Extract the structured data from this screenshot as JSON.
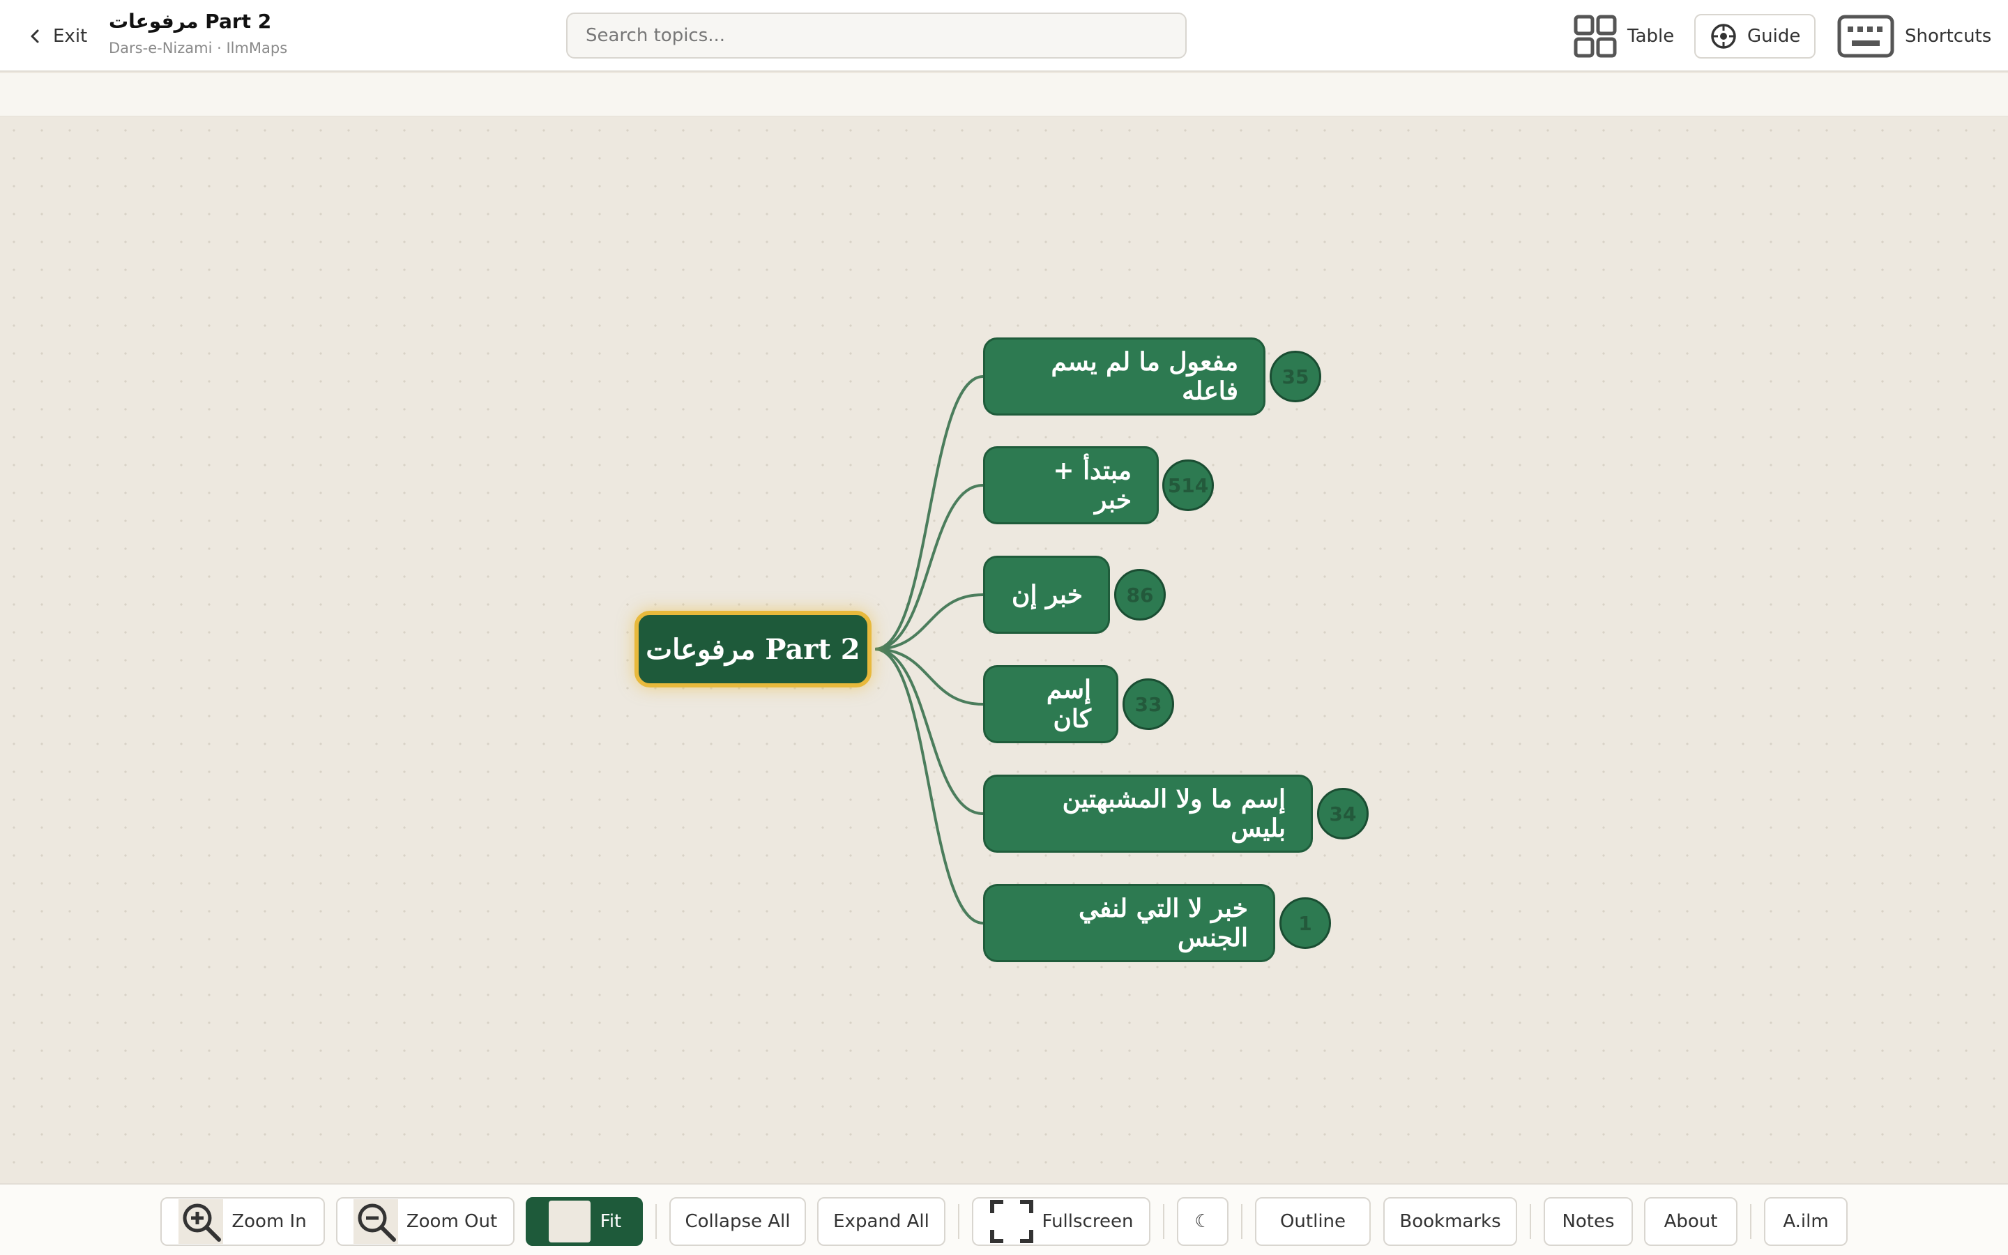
{
  "header": {
    "exit_label": "Exit",
    "title": "مرفوعات Part 2",
    "subtitle": "Dars-e-Nizami · IlmMaps",
    "search_placeholder": "Search topics...",
    "table_label": "Table",
    "guide_label": "Guide",
    "shortcuts_label": "Shortcuts"
  },
  "mindmap": {
    "root": "مرفوعات Part 2",
    "children": [
      {
        "label": "مفعول ما لم يسم فاعله",
        "count": "35"
      },
      {
        "label": "مبتدأ + خبر",
        "count": "514"
      },
      {
        "label": "خبر إن",
        "count": "86"
      },
      {
        "label": "إسم كان",
        "count": "33"
      },
      {
        "label": "إسم ما ولا المشبهتين بليس",
        "count": "34"
      },
      {
        "label": "خبر لا التي لنفي الجنس",
        "count": "1"
      }
    ]
  },
  "toolbar": {
    "zoom_in": "Zoom In",
    "zoom_out": "Zoom Out",
    "fit": "Fit",
    "collapse_all": "Collapse All",
    "expand_all": "Expand All",
    "fullscreen": "Fullscreen",
    "theme": "☾",
    "outline": "Outline",
    "bookmarks": "Bookmarks",
    "notes": "Notes",
    "about": "About",
    "ailm": "A.ilm"
  },
  "colors": {
    "node_fill": "#2d7a51",
    "root_fill": "#1e5a3a",
    "root_border": "#e8b93c",
    "canvas_bg": "#ede8df"
  }
}
